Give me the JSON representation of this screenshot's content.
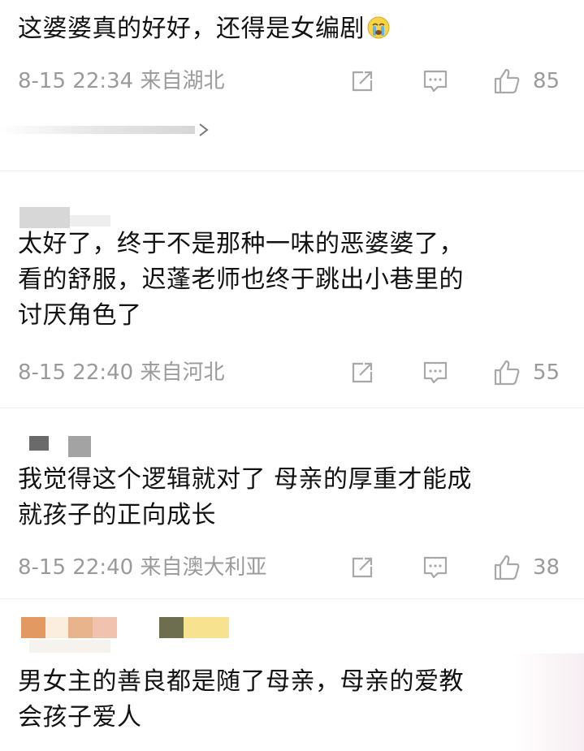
{
  "comments": [
    {
      "text": "这婆婆真的好好，还得是女编剧",
      "emoji_name": "crying-emoji",
      "time": "8-15 22:34",
      "location": "来自湖北",
      "likes": "85"
    },
    {
      "text": "太好了，终于不是那种一味的恶婆婆了，\n看的舒服，迟蓬老师也终于跳出小巷里的\n讨厌角色了",
      "time": "8-15 22:40",
      "location": "来自河北",
      "likes": "55"
    },
    {
      "text": "我觉得这个逻辑就对了 母亲的厚重才能成\n就孩子的正向成长",
      "time": "8-15 22:40",
      "location": "来自澳大利亚",
      "likes": "38"
    },
    {
      "text": "男女主的善良都是随了母亲，母亲的爱教\n会孩子爱人"
    }
  ],
  "icons": {
    "share": "share-icon",
    "comment": "comment-icon",
    "like": "thumbs-up-icon"
  },
  "colors": {
    "meta_gray": "#9a9a9a",
    "text": "#121212",
    "icon_gray": "#a8a8a8"
  }
}
